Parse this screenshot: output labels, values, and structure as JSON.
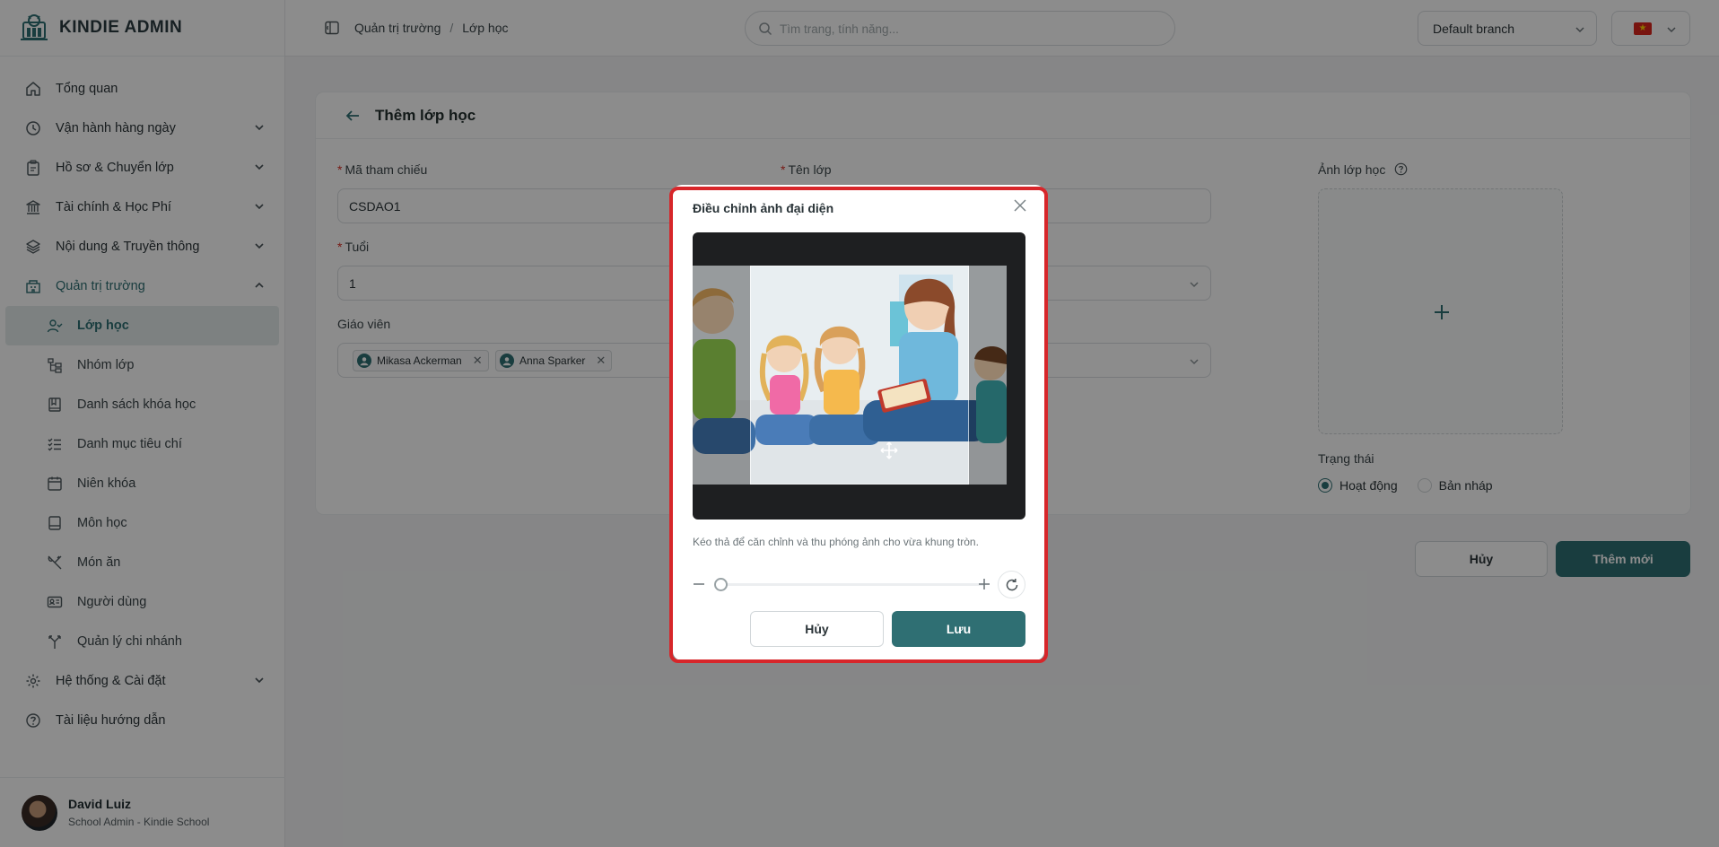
{
  "app": {
    "name": "KINDIE ADMIN"
  },
  "sidebar": {
    "items": [
      {
        "label": "Tổng quan",
        "icon": "home-icon"
      },
      {
        "label": "Vận hành hàng ngày",
        "icon": "clock-icon"
      },
      {
        "label": "Hồ sơ & Chuyển lớp",
        "icon": "clipboard-icon"
      },
      {
        "label": "Tài chính & Học Phí",
        "icon": "bank-icon"
      },
      {
        "label": "Nội dung & Truyền thông",
        "icon": "layers-icon"
      },
      {
        "label": "Quản trị trường",
        "icon": "building-icon"
      }
    ],
    "sub_items": [
      {
        "label": "Lớp học",
        "icon": "user-check-icon"
      },
      {
        "label": "Nhóm lớp",
        "icon": "hierarchy-icon"
      },
      {
        "label": "Danh sách khóa học",
        "icon": "book-icon"
      },
      {
        "label": "Danh mục tiêu chí",
        "icon": "checklist-icon"
      },
      {
        "label": "Niên khóa",
        "icon": "calendar-icon"
      },
      {
        "label": "Môn học",
        "icon": "notebook-icon"
      },
      {
        "label": "Món ăn",
        "icon": "utensils-icon"
      },
      {
        "label": "Người dùng",
        "icon": "id-card-icon"
      },
      {
        "label": "Quản lý chi nhánh",
        "icon": "branch-icon"
      }
    ],
    "bottom_items": [
      {
        "label": "Hệ thống & Cài đặt",
        "icon": "gear-icon"
      },
      {
        "label": "Tài liệu hướng dẫn",
        "icon": "help-circle-icon"
      }
    ],
    "user": {
      "name": "David Luiz",
      "role": "School Admin - Kindie School"
    }
  },
  "topbar": {
    "breadcrumb": [
      "Quản trị trường",
      "/",
      "Lớp học"
    ],
    "search_placeholder": "Tìm trang, tính năng...",
    "branch": "Default branch"
  },
  "form": {
    "title": "Thêm lớp học",
    "ref_label": "Mã tham chiếu",
    "ref_value": "CSDAO1",
    "name_label": "Tên lớp",
    "age_label": "Tuổi",
    "age_value": "1",
    "teacher_label": "Giáo viên",
    "teachers": [
      "Mikasa Ackerman",
      "Anna Sparker"
    ],
    "photo_label": "Ảnh lớp học",
    "status_label": "Trạng thái",
    "status_active": "Hoạt động",
    "status_draft": "Bản nháp",
    "cancel": "Hủy",
    "submit": "Thêm mới"
  },
  "modal": {
    "title": "Điều chỉnh ảnh đại diện",
    "hint": "Kéo thả để căn chỉnh và thu phóng ảnh cho vừa khung tròn.",
    "zoom_level": 0,
    "cancel": "Hủy",
    "save": "Lưu"
  },
  "colors": {
    "accent": "#2f6f73",
    "highlight_frame": "#d7262a"
  }
}
